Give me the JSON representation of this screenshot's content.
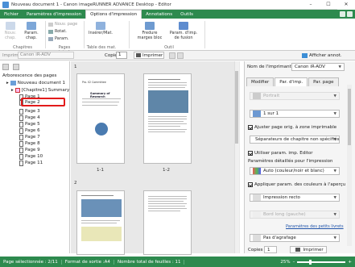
{
  "window": {
    "title": "Nouveau document 1 - Canon imageRUNNER ADVANCE Desktop - Editor"
  },
  "ribbon_tabs": [
    {
      "label": "Fichier"
    },
    {
      "label": "Paramètres d'impression"
    },
    {
      "label": "Options d'impression"
    },
    {
      "label": "Annotations"
    },
    {
      "label": "Outils"
    }
  ],
  "ribbon": {
    "nouv_chap": "Nouv. chap.",
    "param_chap": "Param. chap.",
    "group_chapitres": "Chapitres",
    "nouv_page": "Nouv. page",
    "rotat": "Rotat.",
    "param": "Param.",
    "group_pages_orig": "Pages originales",
    "inserer": "Insérer/Mat.",
    "group_table": "Table des mat.",
    "fredure": "Fredure marges bloc",
    "param_imp": "Param. d'imp. de fusion",
    "group_outil": "Outil"
  },
  "toolbar": {
    "printer_label": "Imprim :",
    "printer_value": "Canon iR-ADV",
    "copies_label": "Copies :",
    "copies_value": "1",
    "print_label": "Imprimer",
    "afficher_label": "Afficher annot."
  },
  "left_panel": {
    "heading": "Arborescence des pages",
    "tree": [
      {
        "label": "Nouveau document 1",
        "kind": "doc"
      },
      {
        "label": "[Chapitre1] Summary o",
        "kind": "chapter"
      },
      {
        "label": "Page 1",
        "kind": "page"
      },
      {
        "label": "Page 2",
        "kind": "page",
        "highlighted": true
      },
      {
        "label": "Page 3",
        "kind": "page"
      },
      {
        "label": "Page 4",
        "kind": "page"
      },
      {
        "label": "Page 5",
        "kind": "page"
      },
      {
        "label": "Page 6",
        "kind": "page"
      },
      {
        "label": "Page 7",
        "kind": "page"
      },
      {
        "label": "Page 8",
        "kind": "page"
      },
      {
        "label": "Page 9",
        "kind": "page"
      },
      {
        "label": "Page 10",
        "kind": "page"
      },
      {
        "label": "Page 11",
        "kind": "page"
      }
    ]
  },
  "center": {
    "chapter_num": "1",
    "page1_title": "Summary of Research",
    "page1_head": "Pro. 02 Committee",
    "caption1": "1-1",
    "caption2": "1-2",
    "num_row2": "2"
  },
  "right_panel": {
    "printer_name_label": "Nom de l'imprimante :",
    "printer_name_value": "Canon iR-ADV",
    "tabs": [
      {
        "label": "Modifier"
      },
      {
        "label": "Par. d'imp."
      },
      {
        "label": "Par. page"
      }
    ],
    "orientation": "Portrait",
    "layout": "1 sur 1",
    "chk_ajuster": "Ajuster page orig. à zone imprimable",
    "separator": "Séparateurs de chapitre non spécifiés",
    "chk_utiliser": "Utiliser param. imp. Editor",
    "details_label": "Paramètres détaillés pour l'impression",
    "color_mode": "Auto (couleur/noir et blanc)",
    "chk_appliquer": "Appliquer param. des couleurs à l'aperçu",
    "print_mode": "Impression recto",
    "binding": "Bord long (gauche)",
    "link_label": "Paramètres des petits livrets",
    "stapling": "Pas d'agrafage",
    "copies_label": "Copies :",
    "copies_value": "1",
    "print_label": "Imprimer"
  },
  "status": {
    "selected": "Page sélectionnée : 2/11",
    "format": "Format de sortie :A4",
    "sheets": "Nombre total de feuilles : 11",
    "zoom": "25%"
  },
  "colors": {
    "accent": "#2d8a4e",
    "highlight": "#e21b1b"
  }
}
